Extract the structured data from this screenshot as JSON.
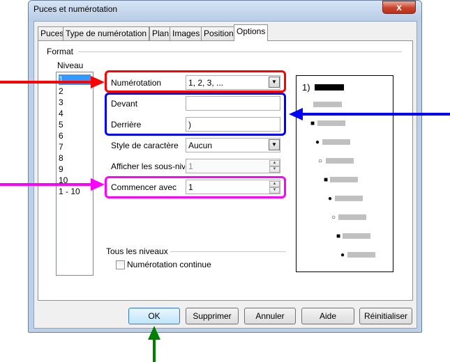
{
  "window": {
    "title": "Puces et numérotation",
    "close_glyph": "x"
  },
  "tabs": [
    {
      "label": "Puces"
    },
    {
      "label": "Type de numérotation"
    },
    {
      "label": "Plan"
    },
    {
      "label": "Images"
    },
    {
      "label": "Position"
    },
    {
      "label": "Options",
      "active": true
    }
  ],
  "format": {
    "heading": "Format",
    "niveau_label": "Niveau",
    "levels": [
      "1",
      "2",
      "3",
      "4",
      "5",
      "6",
      "7",
      "8",
      "9",
      "10",
      "1 - 10"
    ],
    "selected_level": "1",
    "numerotation": {
      "label": "Numérotation",
      "value": "1, 2, 3, ..."
    },
    "devant": {
      "label": "Devant",
      "value": ""
    },
    "derriere": {
      "label": "Derrière",
      "value": ")"
    },
    "style_caractere": {
      "label": "Style de caractère",
      "value": "Aucun"
    },
    "afficher_sous_niveaux": {
      "label": "Afficher les sous-niv",
      "value": "1"
    },
    "commencer_avec": {
      "label": "Commencer avec",
      "value": "1"
    }
  },
  "tous_niveaux": {
    "heading": "Tous les niveaux",
    "numerotation_continue": {
      "label": "Numérotation continue",
      "checked": false
    }
  },
  "preview": {
    "first_label": "1)"
  },
  "buttons": {
    "ok": "OK",
    "supprimer": "Supprimer",
    "annuler": "Annuler",
    "aide": "Aide",
    "reinitialiser": "Réinitialiser"
  },
  "annotation_colors": {
    "red": "#ff0000",
    "blue": "#0000ff",
    "magenta": "#ff00ff",
    "green": "#008000"
  }
}
